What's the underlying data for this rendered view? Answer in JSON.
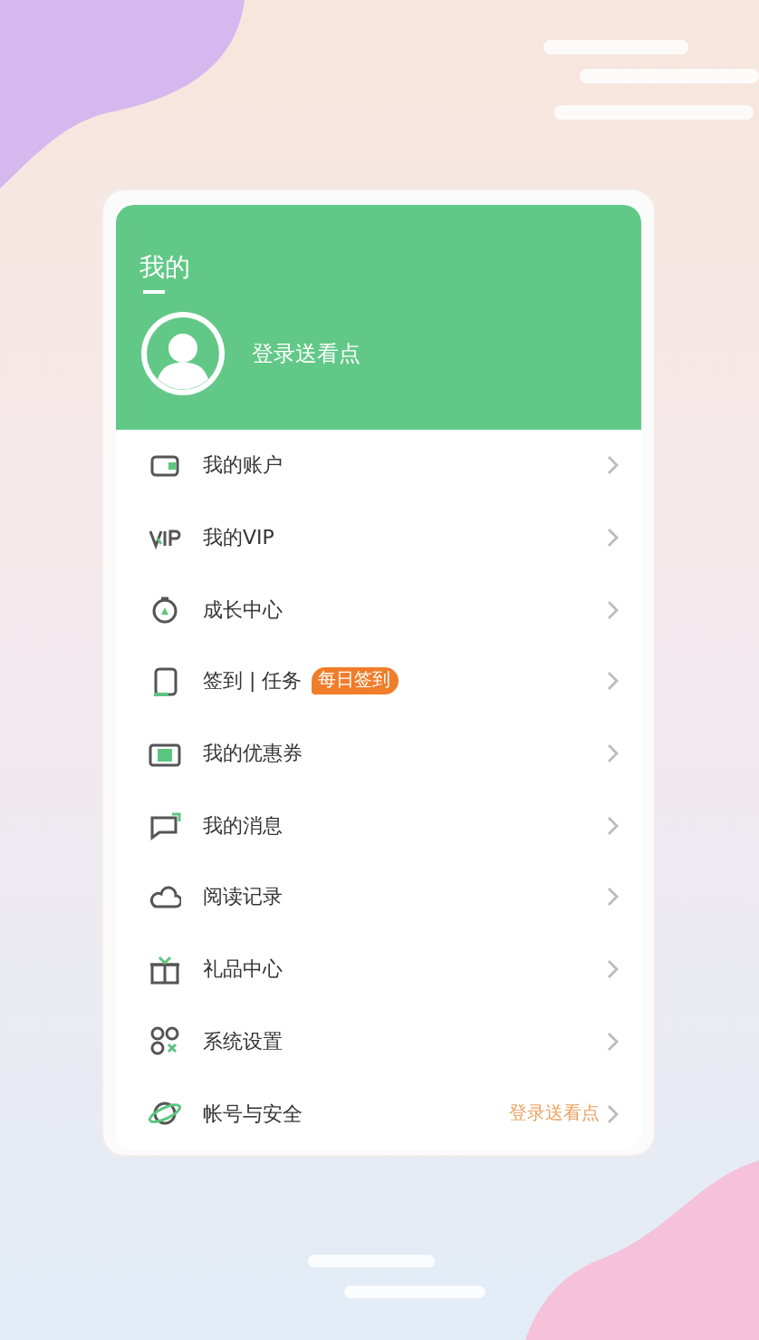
{
  "header": {
    "title": "我的",
    "login_text": "登录送看点"
  },
  "menu": [
    {
      "label": "我的账户"
    },
    {
      "label": "我的VIP"
    },
    {
      "label": "成长中心"
    },
    {
      "label": "签到 | 任务",
      "badge": "每日签到"
    },
    {
      "label": "我的优惠券"
    },
    {
      "label": "我的消息"
    },
    {
      "label": "阅读记录"
    },
    {
      "label": "礼品中心"
    },
    {
      "label": "系统设置"
    },
    {
      "label": "帐号与安全",
      "trailing": "登录送看点"
    }
  ]
}
